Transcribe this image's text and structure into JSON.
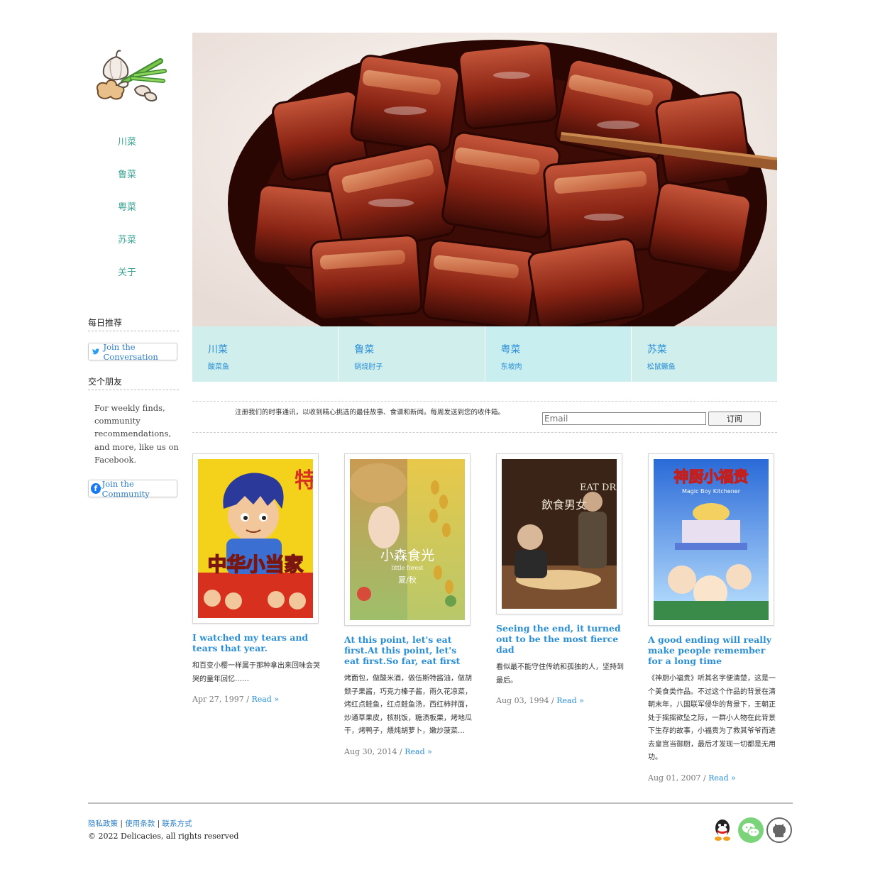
{
  "nav": {
    "items": [
      "川菜",
      "鲁菜",
      "粤菜",
      "苏菜",
      "关于"
    ]
  },
  "sidebar": {
    "daily_heading": "每日推荐",
    "twitter_button": "Join the Conversation",
    "friends_heading": "交个朋友",
    "facebook_text": "For weekly finds, community recommendations, and more, like us on Facebook.",
    "facebook_button": "Join the Community"
  },
  "categories": [
    {
      "title": "川菜",
      "dish": "酸菜鱼"
    },
    {
      "title": "鲁菜",
      "dish": "锅烧肘子"
    },
    {
      "title": "粤菜",
      "dish": "东坡肉"
    },
    {
      "title": "苏菜",
      "dish": "松鼠鳜鱼"
    }
  ],
  "newsletter": {
    "text": "注册我们的时事通讯，以收到精心挑选的最佳故事、食谱和新闻。每周发送到您的收件箱。",
    "placeholder": "Email",
    "button": "订阅"
  },
  "posts": [
    {
      "poster_title": "中华小当家",
      "poster_badge": "特",
      "title": "I watched my tears and tears that year.",
      "body": "和百变小樱一样属于那种拿出来回味会哭哭的童年回忆……",
      "date": "Apr 27, 1997",
      "read": "Read »"
    },
    {
      "poster_title": "小森食光",
      "poster_subtitle": "little forest",
      "poster_season": "夏/秋",
      "title": "At this point, let's eat first.At this point, let's eat first.So far, eat first",
      "body": "烤面包，做酸米酒，做伍斯特酱油，做胡颓子果酱，巧克力榛子酱，雨久花凉菜，烤红点鲑鱼，红点鲑鱼汤，西红柿拌面，炒通草果皮，核桃饭，糖渍板栗，烤地瓜干，烤鸭子，煨炖胡萝卜，嫩炒菠菜…",
      "date": "Aug 30, 2014",
      "read": "Read »"
    },
    {
      "poster_title": "EAT DRINK MAN WOMAN",
      "poster_cn": "飲食男女",
      "title": "Seeing the end, it turned out to be the most fierce dad",
      "body": "看似最不能守住传统和孤独的人，坚持到最后。",
      "date": "Aug 03, 1994",
      "read": "Read »"
    },
    {
      "poster_title": "神厨小福贵",
      "poster_subtitle": "Magic Boy Kitchener",
      "title": "A good ending will really make people remember for a long time",
      "body": "《神厨小福贵》听其名字便清楚，这是一个美食类作品。不过这个作品的背景在清朝末年，八国联军侵华的背景下，王朝正处于摇摇欲坠之际，一群小人物在此背景下生存的故事，小福贵为了救其爷爷而进去皇宫当御厨，最后才发现一切都是无用功。",
      "date": "Aug 01, 2007",
      "read": "Read »"
    }
  ],
  "footer": {
    "links": [
      "隐私政策",
      "使用条款",
      "联系方式"
    ],
    "separator": "|",
    "copyright": "© 2022 Delicacies, all rights reserved",
    "social": [
      "qq-icon",
      "wechat-icon",
      "github-icon"
    ]
  },
  "colors": {
    "nav": "#3aa393",
    "link": "#2a8fd6",
    "category_bg": "#d0eeec"
  }
}
